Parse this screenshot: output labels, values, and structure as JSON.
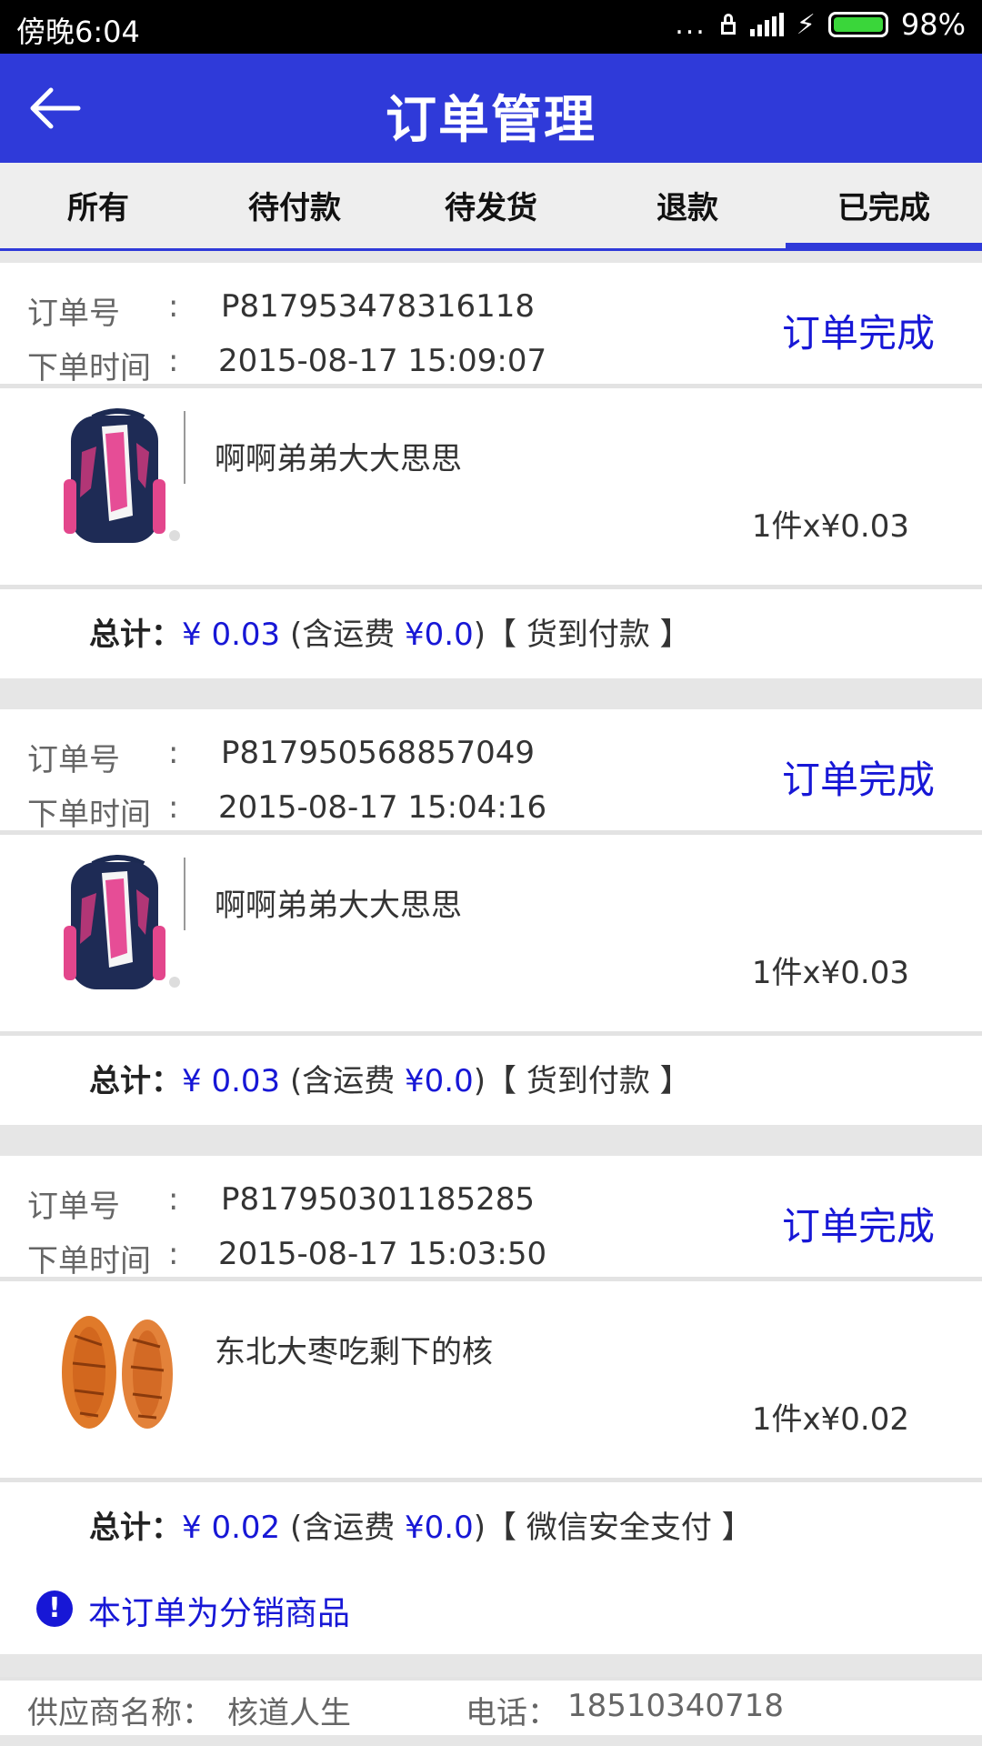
{
  "status_bar": {
    "time": "傍晚6:04",
    "dots": "...",
    "battery": "98%"
  },
  "header": {
    "title": "订单管理",
    "back_icon": "arrow-left-icon"
  },
  "tabs": [
    {
      "label": "所有",
      "active": false
    },
    {
      "label": "待付款",
      "active": false
    },
    {
      "label": "待发货",
      "active": false
    },
    {
      "label": "退款",
      "active": false
    },
    {
      "label": "已完成",
      "active": true
    }
  ],
  "labels": {
    "order_no": "订单号",
    "order_time": "下单时间",
    "colon": ":",
    "total": "总计：",
    "shipping_open": "(含运费 ",
    "shipping_close": ")",
    "bracket_open": "【 ",
    "bracket_close": " 】"
  },
  "orders": [
    {
      "order_no": "P817953478316118",
      "time": "2015-08-17 15:09:07",
      "status": "订单完成",
      "product": {
        "name": "啊啊弟弟大大思思",
        "qty_price": "1件x¥0.03",
        "image": "backpack"
      },
      "total": "¥ 0.03",
      "shipping": "¥0.0",
      "payment": "货到付款"
    },
    {
      "order_no": "P817950568857049",
      "time": "2015-08-17 15:04:16",
      "status": "订单完成",
      "product": {
        "name": "啊啊弟弟大大思思",
        "qty_price": "1件x¥0.03",
        "image": "backpack"
      },
      "total": "¥ 0.03",
      "shipping": "¥0.0",
      "payment": "货到付款"
    },
    {
      "order_no": "P817950301185285",
      "time": "2015-08-17 15:03:50",
      "status": "订单完成",
      "product": {
        "name": "东北大枣吃剩下的核",
        "qty_price": "1件x¥0.02",
        "image": "date-pits"
      },
      "total": "¥ 0.02",
      "shipping": "¥0.0",
      "payment": "微信安全支付",
      "notice": "本订单为分销商品",
      "supplier": {
        "name_label": "供应商名称：",
        "name": "核道人生",
        "phone_label": "电话：",
        "phone": "18510340718"
      }
    }
  ],
  "colors": {
    "primary": "#2f3ad9",
    "link_blue": "#1717d6",
    "battery": "#3ad63a"
  }
}
